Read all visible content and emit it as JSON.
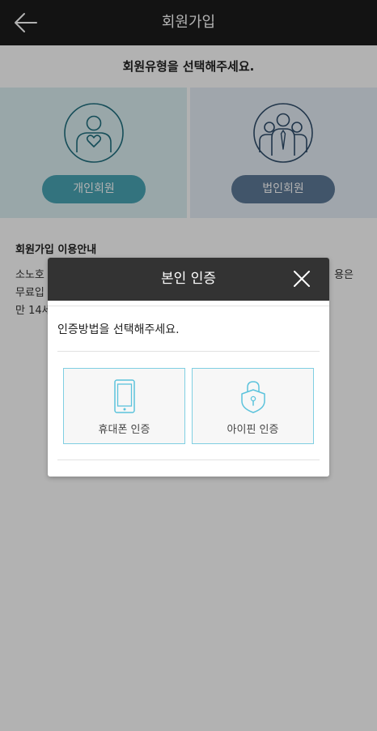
{
  "header": {
    "title": "회원가입"
  },
  "subtitle": "회원유형을 선택해주세요.",
  "member_types": {
    "personal_label": "개인회원",
    "corporate_label": "법인회원"
  },
  "info": {
    "title": "회원가입 이용안내",
    "line1_start": "소노호",
    "line1_end": "용은",
    "line2_start": "무료입",
    "line3_start": "만 14세"
  },
  "modal": {
    "title": "본인 인증",
    "prompt": "인증방법을 선택해주세요.",
    "methods": {
      "phone_label": "휴대폰 인증",
      "ipin_label": "아이핀 인증"
    }
  },
  "colors": {
    "header_bg": "#1c1c1c",
    "personal_accent": "#4aa5b5",
    "corporate_accent": "#5e7a98",
    "method_border": "#7fcfe2"
  }
}
